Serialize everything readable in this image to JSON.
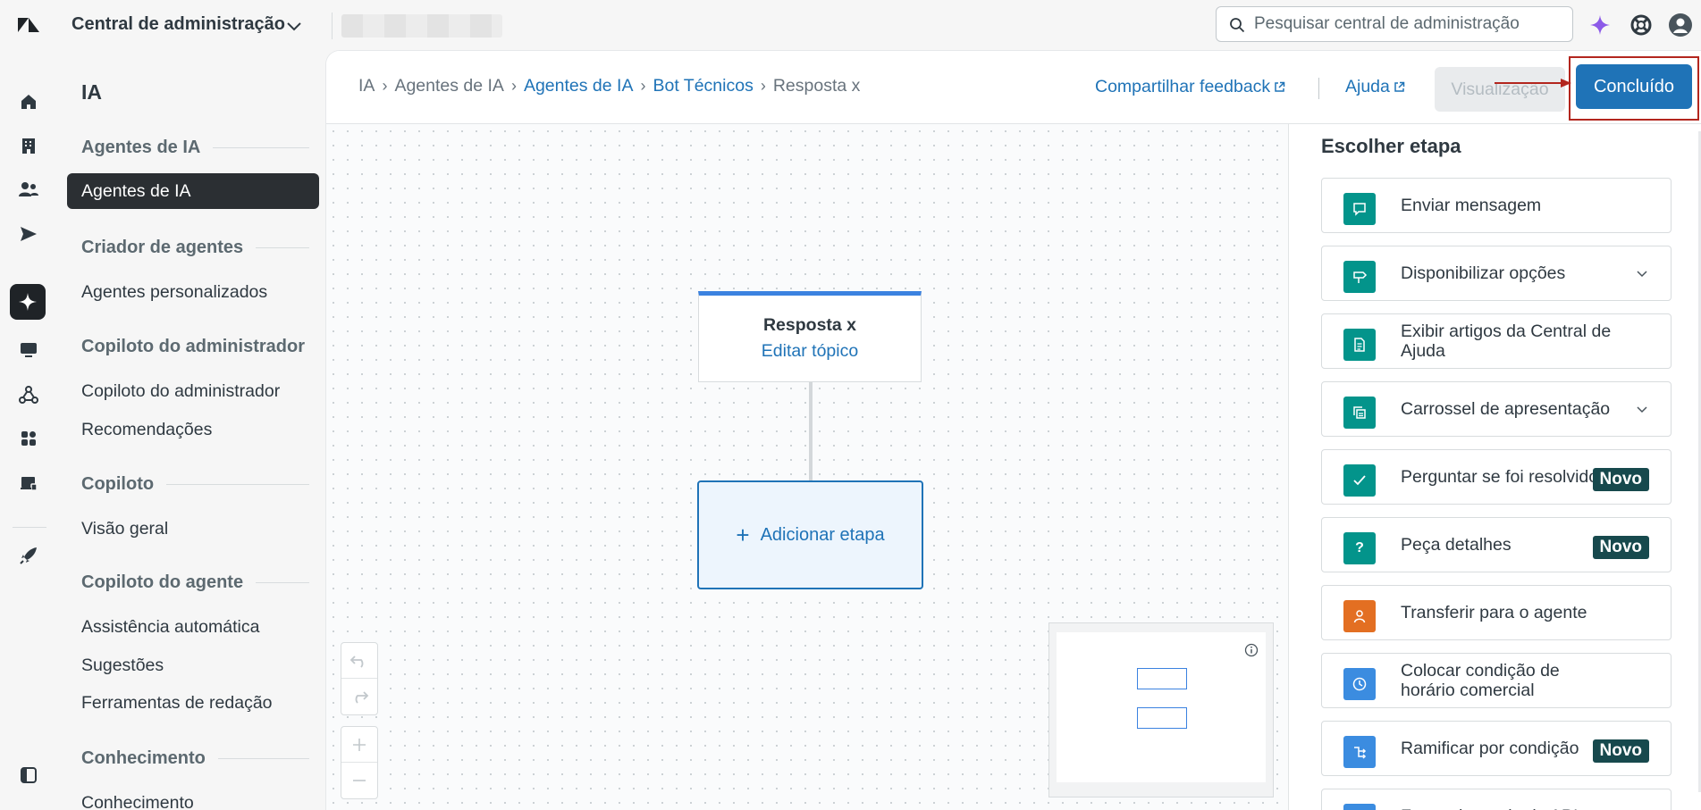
{
  "topbar": {
    "app_title": "Central de administração",
    "search_placeholder": "Pesquisar central de administração"
  },
  "nav": {
    "title": "IA",
    "sections": [
      {
        "label": "Agentes de IA",
        "items": [
          {
            "label": "Agentes de IA",
            "active": true
          }
        ]
      },
      {
        "label": "Criador de agentes",
        "items": [
          {
            "label": "Agentes personalizados"
          }
        ]
      },
      {
        "label": "Copiloto do administrador",
        "items": [
          {
            "label": "Copiloto do administrador"
          },
          {
            "label": "Recomendações"
          }
        ]
      },
      {
        "label": "Copiloto",
        "items": [
          {
            "label": "Visão geral"
          }
        ]
      },
      {
        "label": "Copiloto do agente",
        "items": [
          {
            "label": "Assistência automática"
          },
          {
            "label": "Sugestões"
          },
          {
            "label": "Ferramentas de redação"
          }
        ]
      },
      {
        "label": "Conhecimento",
        "items": [
          {
            "label": "Conhecimento"
          }
        ]
      }
    ]
  },
  "header": {
    "breadcrumbs": [
      "IA",
      "Agentes de IA",
      "Agentes de IA",
      "Bot Técnicos",
      "Resposta x"
    ],
    "feedback_link": "Compartilhar feedback",
    "help_link": "Ajuda",
    "preview_button": "Visualização",
    "done_button": "Concluído"
  },
  "canvas": {
    "topic_title": "Resposta x",
    "topic_edit": "Editar tópico",
    "add_step": "Adicionar etapa"
  },
  "steps_panel": {
    "title": "Escolher etapa",
    "badge_label": "Novo",
    "steps": [
      {
        "label": "Enviar mensagem",
        "icon": "message-icon"
      },
      {
        "label": "Disponibilizar opções",
        "icon": "signpost-icon",
        "expandable": true
      },
      {
        "label": "Exibir artigos da Central de Ajuda",
        "icon": "article-icon"
      },
      {
        "label": "Carrossel de apresentação",
        "icon": "carousel-icon",
        "expandable": true
      },
      {
        "label": "Perguntar se foi resolvido",
        "icon": "check-icon",
        "badge": true
      },
      {
        "label": "Peça detalhes",
        "icon": "question-icon",
        "badge": true
      },
      {
        "label": "Transferir para o agente",
        "icon": "person-icon"
      },
      {
        "label": "Colocar condição de horário comercial",
        "icon": "clock-icon"
      },
      {
        "label": "Ramificar por condição",
        "icon": "branch-icon",
        "badge": true
      },
      {
        "label": "Fazer chamada de API",
        "icon": "plug-icon"
      }
    ]
  },
  "colors": {
    "accent": "#1f73b7",
    "teal": "#03948b",
    "orange": "#e36f22",
    "badge": "#17494d",
    "highlight_frame": "#b3261e"
  }
}
